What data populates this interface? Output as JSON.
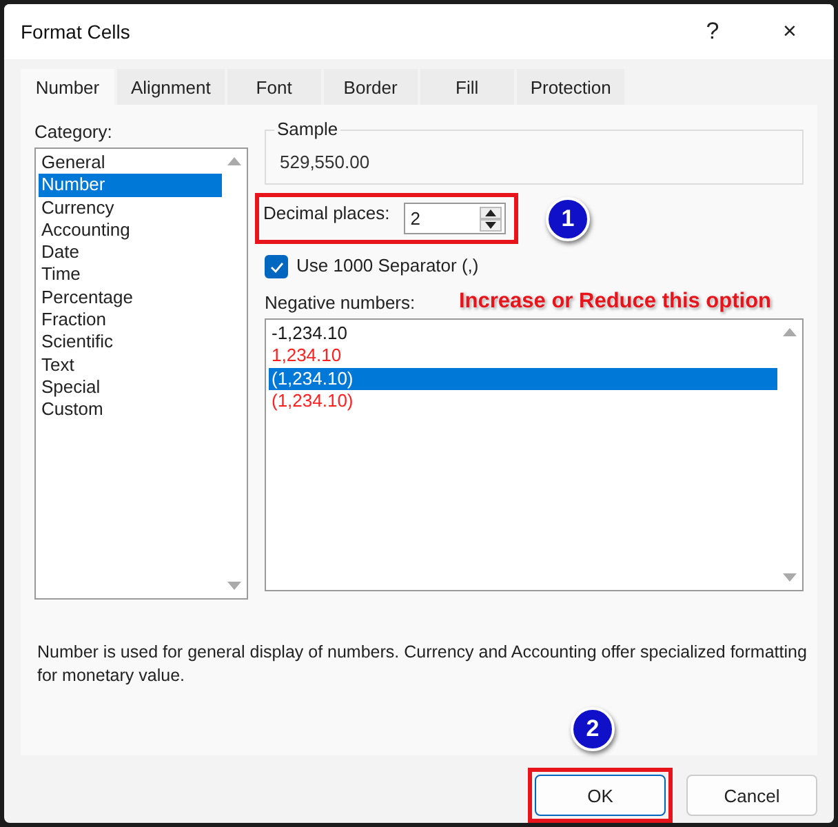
{
  "window": {
    "title": "Format Cells",
    "help": "?",
    "close": "×"
  },
  "tabs": [
    {
      "label": "Number",
      "selected": true
    },
    {
      "label": "Alignment",
      "selected": false
    },
    {
      "label": "Font",
      "selected": false
    },
    {
      "label": "Border",
      "selected": false
    },
    {
      "label": "Fill",
      "selected": false
    },
    {
      "label": "Protection",
      "selected": false
    }
  ],
  "category": {
    "label": "Category:",
    "items": [
      {
        "label": "General",
        "selected": false
      },
      {
        "label": "Number",
        "selected": true
      },
      {
        "label": "Currency",
        "selected": false
      },
      {
        "label": "Accounting",
        "selected": false
      },
      {
        "label": "Date",
        "selected": false
      },
      {
        "label": "Time",
        "selected": false
      },
      {
        "label": "Percentage",
        "selected": false
      },
      {
        "label": "Fraction",
        "selected": false
      },
      {
        "label": "Scientific",
        "selected": false
      },
      {
        "label": "Text",
        "selected": false
      },
      {
        "label": "Special",
        "selected": false
      },
      {
        "label": "Custom",
        "selected": false
      }
    ]
  },
  "sample": {
    "label": "Sample",
    "value": "529,550.00"
  },
  "decimal_places": {
    "label": "Decimal places:",
    "value": "2"
  },
  "separator": {
    "label": "Use 1000 Separator (,)",
    "checked": true
  },
  "negative_numbers": {
    "label": "Negative numbers:",
    "items": [
      {
        "label": "-1,234.10",
        "color": "#1a1a1a",
        "selected": false
      },
      {
        "label": "1,234.10",
        "color": "#ff2020",
        "selected": false
      },
      {
        "label": "(1,234.10)",
        "selected": true
      },
      {
        "label": "(1,234.10)",
        "color": "#ff2020",
        "selected": false
      }
    ]
  },
  "description": "Number is used for general display of numbers.  Currency and Accounting offer specialized formatting for monetary value.",
  "buttons": [
    {
      "label": "OK",
      "kind": "primary"
    },
    {
      "label": "Cancel",
      "kind": "secondary"
    }
  ],
  "annotations": [
    {
      "kind": "badge",
      "text": "1"
    },
    {
      "kind": "note",
      "text": "Increase or Reduce this option"
    },
    {
      "kind": "badge",
      "text": "2"
    }
  ]
}
